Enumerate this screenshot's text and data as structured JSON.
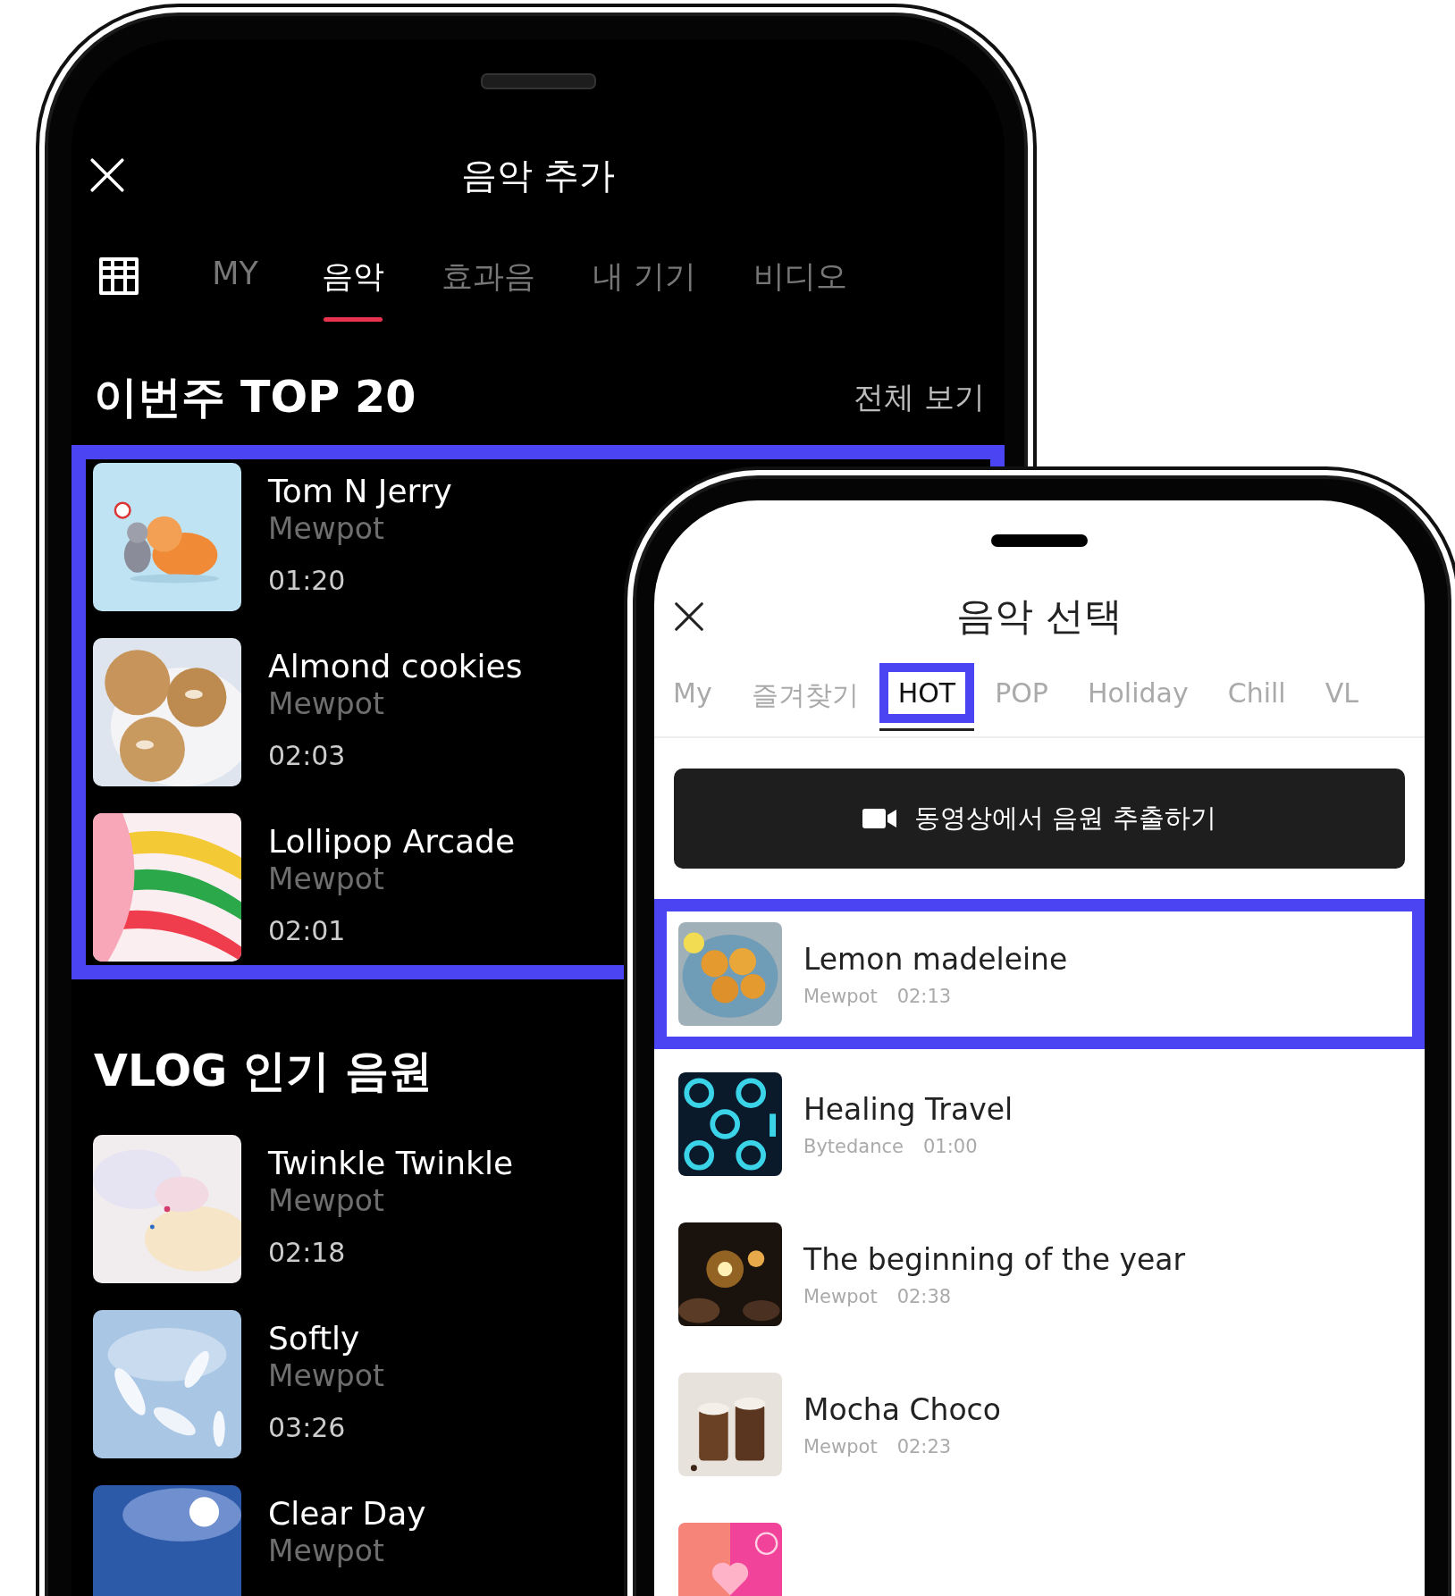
{
  "left_screen": {
    "title": "음악 추가",
    "tabs": [
      {
        "kind": "icon",
        "selected": false
      },
      {
        "kind": "text",
        "label": "MY",
        "selected": false
      },
      {
        "kind": "text",
        "label": "음악",
        "selected": true
      },
      {
        "kind": "text",
        "label": "효과음",
        "selected": false
      },
      {
        "kind": "text",
        "label": "내 기기",
        "selected": false
      },
      {
        "kind": "text",
        "label": "비디오",
        "selected": false
      }
    ],
    "sections": [
      {
        "title": "이번주 TOP 20",
        "link": "전체 보기",
        "highlighted": true,
        "tracks": [
          {
            "title": "Tom N Jerry",
            "artist": "Mewpot",
            "duration": "01:20"
          },
          {
            "title": "Almond cookies",
            "artist": "Mewpot",
            "duration": "02:03"
          },
          {
            "title": "Lollipop Arcade",
            "artist": "Mewpot",
            "duration": "02:01"
          }
        ]
      },
      {
        "title": "VLOG 인기 음원",
        "highlighted": false,
        "tracks": [
          {
            "title": "Twinkle Twinkle",
            "artist": "Mewpot",
            "duration": "02:18"
          },
          {
            "title": "Softly",
            "artist": "Mewpot",
            "duration": "03:26"
          },
          {
            "title": "Clear Day",
            "artist": "Mewpot"
          }
        ]
      }
    ]
  },
  "right_screen": {
    "title": "음악 선택",
    "tabs": [
      {
        "label": "My",
        "selected": false,
        "highlighted": false
      },
      {
        "label": "즐겨찾기",
        "selected": false,
        "highlighted": false
      },
      {
        "label": "HOT",
        "selected": true,
        "highlighted": true
      },
      {
        "label": "POP",
        "selected": false,
        "highlighted": false
      },
      {
        "label": "Holiday",
        "selected": false,
        "highlighted": false
      },
      {
        "label": "Chill",
        "selected": false,
        "highlighted": false
      },
      {
        "label": "VL",
        "selected": false,
        "highlighted": false
      }
    ],
    "extract_button": {
      "label": "동영상에서 음원 추출하기"
    },
    "tracks": [
      {
        "title": "Lemon madeleine",
        "artist": "Mewpot",
        "duration": "02:13",
        "highlighted": true
      },
      {
        "title": "Healing Travel",
        "artist": "Bytedance",
        "duration": "01:00",
        "highlighted": false
      },
      {
        "title": "The beginning of the year",
        "artist": "Mewpot",
        "duration": "02:38",
        "highlighted": false
      },
      {
        "title": "Mocha Choco",
        "artist": "Mewpot",
        "duration": "02:23",
        "highlighted": false
      },
      {
        "highlighted": false
      }
    ]
  }
}
